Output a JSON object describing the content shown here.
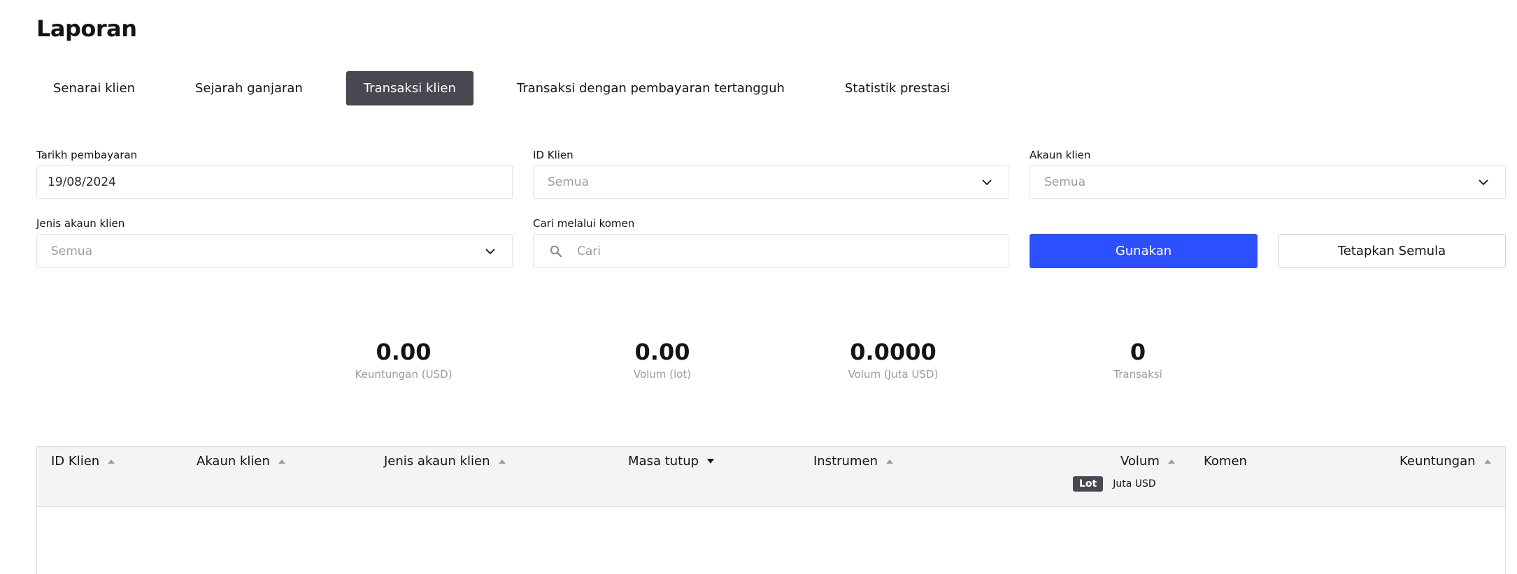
{
  "page": {
    "title": "Laporan"
  },
  "tabs": [
    {
      "label": "Senarai klien",
      "active": false
    },
    {
      "label": "Sejarah ganjaran",
      "active": false
    },
    {
      "label": "Transaksi klien",
      "active": true
    },
    {
      "label": "Transaksi dengan pembayaran tertangguh",
      "active": false
    },
    {
      "label": "Statistik prestasi",
      "active": false
    }
  ],
  "filters": {
    "payment_date": {
      "label": "Tarikh pembayaran",
      "value": "19/08/2024"
    },
    "client_id": {
      "label": "ID Klien",
      "placeholder": "Semua",
      "icon": "chevron-down-icon"
    },
    "client_account": {
      "label": "Akaun klien",
      "placeholder": "Semua",
      "icon": "chevron-down-icon"
    },
    "account_type": {
      "label": "Jenis akaun klien",
      "placeholder": "Semua",
      "icon": "chevron-down-icon"
    },
    "comment_search": {
      "label": "Cari melalui komen",
      "placeholder": "Cari",
      "icon": "search-icon"
    },
    "apply_label": "Gunakan",
    "reset_label": "Tetapkan Semula"
  },
  "stats": [
    {
      "value": "0.00",
      "label": "Keuntungan (USD)"
    },
    {
      "value": "0.00",
      "label": "Volum (lot)"
    },
    {
      "value": "0.0000",
      "label": "Volum (Juta USD)"
    },
    {
      "value": "0",
      "label": "Transaksi"
    }
  ],
  "table": {
    "columns": [
      {
        "label": "ID Klien",
        "sort": "asc"
      },
      {
        "label": "Akaun klien",
        "sort": "asc"
      },
      {
        "label": "Jenis akaun klien",
        "sort": "asc"
      },
      {
        "label": "Masa tutup",
        "sort": "desc-active"
      },
      {
        "label": "Instrumen",
        "sort": "asc"
      },
      {
        "label": "Volum",
        "sort": "asc"
      },
      {
        "label": "Komen",
        "sort": "none"
      },
      {
        "label": "Keuntungan",
        "sort": "asc"
      }
    ],
    "volume_units": {
      "selected": "Lot",
      "other": "Juta USD"
    },
    "rows": []
  },
  "colors": {
    "primary": "#2c50ff",
    "active_tab": "#4a4750",
    "muted_text": "#9a9b9f"
  }
}
